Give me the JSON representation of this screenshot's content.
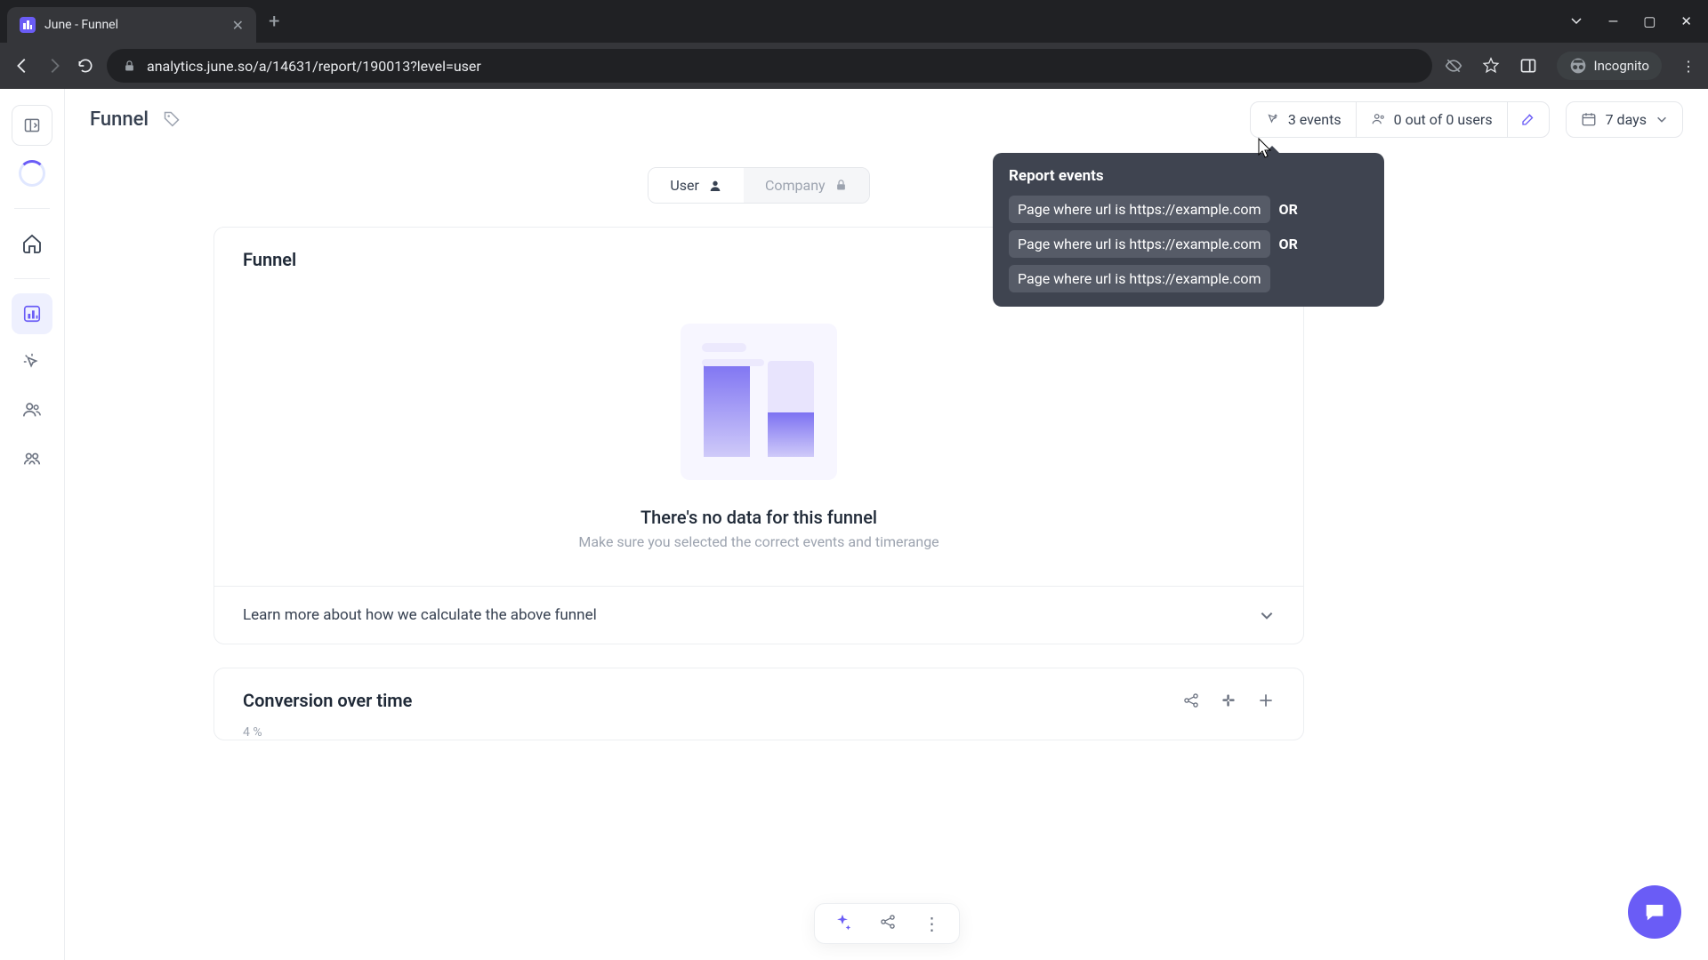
{
  "browser": {
    "tab_title": "June - Funnel",
    "url": "analytics.june.so/a/14631/report/190013?level=user",
    "incognito_label": "Incognito"
  },
  "topbar": {
    "breadcrumb_title": "Funnel",
    "events_count": "3 events",
    "users_count": "0 out of 0 users",
    "date_range": "7 days"
  },
  "tooltip": {
    "title": "Report events",
    "events": [
      {
        "text": "Page where url is https://example.com",
        "or": "OR"
      },
      {
        "text": "Page where url is https://example.com",
        "or": "OR"
      },
      {
        "text": "Page where url is https://example.com",
        "or": ""
      }
    ]
  },
  "segment": {
    "user": "User",
    "company": "Company"
  },
  "funnel_card": {
    "title": "Funnel",
    "empty_heading": "There's no data for this funnel",
    "empty_sub": "Make sure you selected the correct events and timerange",
    "learn_more": "Learn more about how we calculate the above funnel"
  },
  "conversion_card": {
    "title": "Conversion over time",
    "yaxis": "4 %"
  }
}
